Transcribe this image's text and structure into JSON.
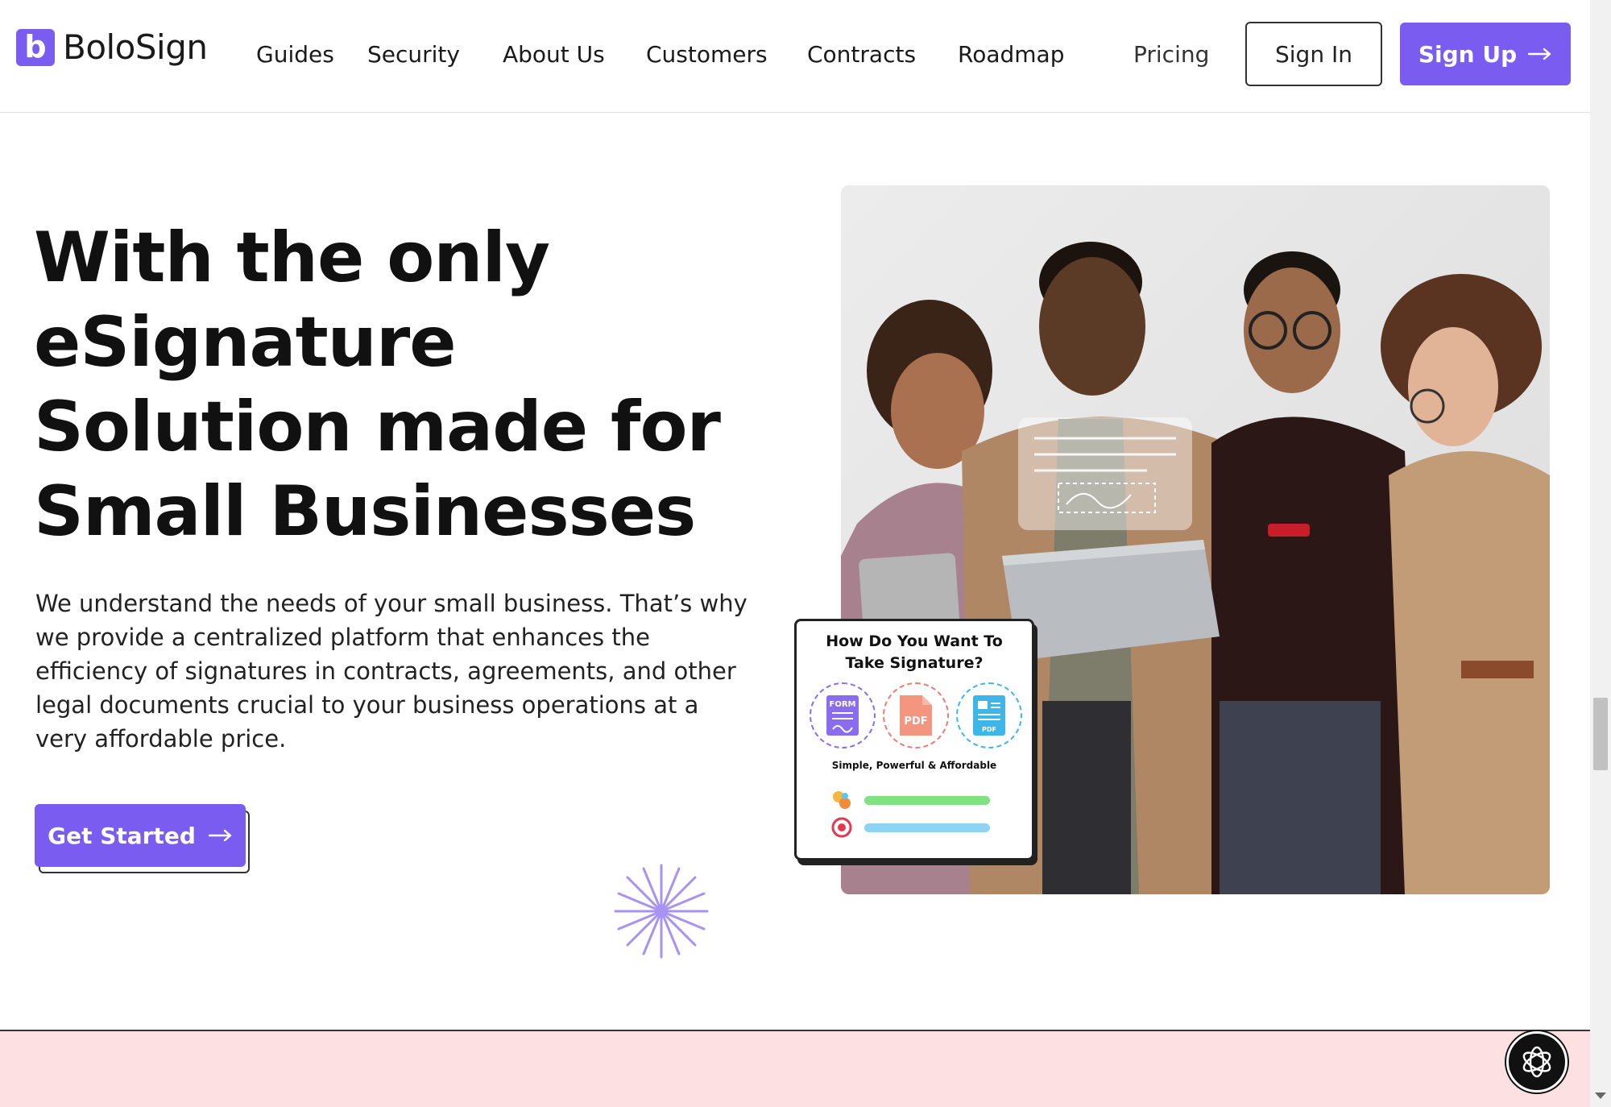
{
  "brand": {
    "name": "BoloSign",
    "mark": "b",
    "accent": "#7b5cf0"
  },
  "nav": {
    "links": [
      "Guides",
      "Security",
      "About Us",
      "Customers",
      "Contracts",
      "Roadmap",
      "Pricing"
    ],
    "sign_in": "Sign In",
    "sign_up": "Sign Up",
    "sign_up_icon": "arrow-right-icon"
  },
  "hero": {
    "title_lines": [
      "With the only",
      "eSignature",
      "Solution made for",
      "Small Businesses"
    ],
    "description_lines": [
      "We understand the needs of your small business. That’s why",
      "we provide a centralized platform that enhances the",
      "efficiency of signatures in contracts, agreements, and other",
      "legal documents crucial to your business operations at a",
      "very affordable price."
    ],
    "cta": "Get Started",
    "cta_icon": "arrow-right-icon"
  },
  "signature_card": {
    "title_lines": [
      "How Do You Want To",
      "Take Signature?"
    ],
    "options": [
      {
        "label": "FORM",
        "icon": "form-icon",
        "color": "#8a6cf0"
      },
      {
        "label": "PDF",
        "icon": "pdf-icon",
        "color": "#f07a6c"
      },
      {
        "label": "PDF",
        "icon": "document-icon",
        "color": "#3fb6e8"
      }
    ],
    "tagline": "Simple, Powerful & Affordable",
    "rows": [
      {
        "icon": "puzzle-icon",
        "bar_color": "#7ee37f"
      },
      {
        "icon": "target-icon",
        "bar_color": "#8fd3f4"
      }
    ]
  },
  "chat": {
    "icon": "chatbot-icon"
  }
}
